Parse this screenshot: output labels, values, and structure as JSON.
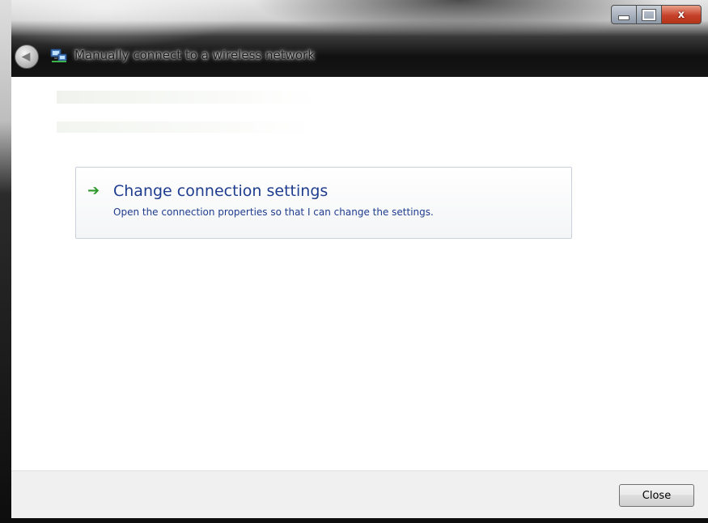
{
  "window": {
    "title": "Manually connect to a wireless network",
    "caption_buttons": {
      "minimize_icon": "minimize-icon",
      "maximize_icon": "maximize-icon",
      "close_icon": "close-icon",
      "close_glyph": "x"
    }
  },
  "nav": {
    "back_icon": "back-arrow-icon",
    "back_glyph": "◀",
    "network_icon": "network-icon"
  },
  "command_link": {
    "title": "Change connection settings",
    "description": "Open the connection properties so that I can change the settings.",
    "arrow_glyph": "➔",
    "arrow_color": "#2e9a2e",
    "text_color": "#1f3d8f"
  },
  "footer": {
    "close_label": "Close"
  }
}
